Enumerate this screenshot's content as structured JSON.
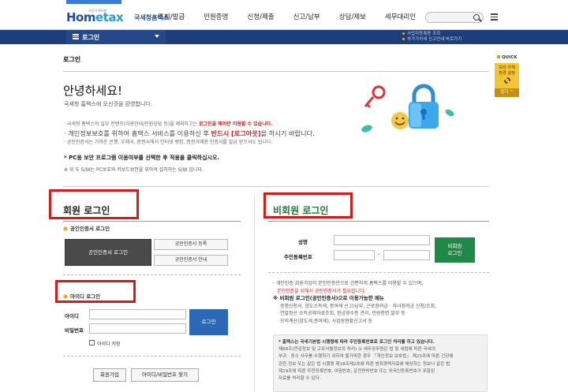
{
  "header": {
    "logo_text_a": "Hom",
    "logo_text_b": "etax",
    "logo_tag": "국민이 편리한",
    "agency": "국세청홈택스",
    "menu": [
      "조회/발급",
      "민원증명",
      "신청/제출",
      "신고/납부",
      "상담/제보",
      "세무대리인"
    ],
    "search_placeholder": ""
  },
  "locbar": {
    "label": "로그인",
    "notice1": "사업자등록증 조회",
    "notice2": "부가가치세 신고안내 바로가기"
  },
  "page": {
    "title": "로그인",
    "hello": "안녕하세요!",
    "welcome": "국세청 홈택스에 오신것을 환영합니다."
  },
  "notes": {
    "l1a": "· 국세청 홈택스의 일부 컨텐츠(이용안내/민원상담 등)을 제외하고는 ",
    "l1b": "로그인을 해야만 이용할 수 있습니다.",
    "l2a": "· 개인정보보호를 위하여 홈택스 서비스를 이용하신 후 ",
    "l2b": "반드시 [로그아웃]",
    "l2c": "을 하시기 바랍니다.",
    "l3": "· 공인인증서는 가까운 은행, 우체국, 증권사에서 인터넷 뱅킹, 증권거래용 인증서를 발급 받으셔도 됩니다.",
    "pc": "* PC용 보안 프로그램 이용여부를 선택한 후 적용을 클릭하십시오.",
    "pc2": "※ 위 두 S/W는 PC보호와 키보드보안을 위하여 설치하는 S/W 입니다."
  },
  "quick": {
    "header": "QUICK",
    "box": [
      "보라 우체",
      "환경 설정"
    ],
    "fold": "접기 ^"
  },
  "member": {
    "heading": "회원 로그인",
    "cert_sub": "공인인증서 로그인",
    "cert_login": "공인인증서 로그인",
    "cert_register": "공인인증서 등록",
    "cert_guide": "공인인증서 안내",
    "id_sub": "아이디 로그인",
    "id_label": "아이디",
    "pw_label": "비밀번호",
    "login_btn": "로그인",
    "save_id": "아이디 저장",
    "join": "회원가입",
    "find": "아이디/비밀번호 찾기"
  },
  "guest": {
    "heading": "비회원 로그인",
    "name_label": "성명",
    "rrn_label": "주민등록번호",
    "rrn_sep": "-",
    "login_btn_1": "비회원",
    "login_btn_2": "로그인",
    "n1": "· 개인인증 회원가입이 본인인증만으로 간편하게 홈택스를 이용할 수 있으며,",
    "n1b": "본인인증을 위해서 공인인증서가 필요합니다.",
    "n2": "※ 비회원 로그인(공인인증서)으로 이용가능한 메뉴",
    "n3": "증명신청서, 양도소득세, 증여세 신고/납부, 근로장려금 · 자녀장려금 신청/조회,",
    "n4": "연말정산 소득공제자료조회, 현금영수증 관리, 민원증명 발부 등",
    "n5": "모의계산(양도세,증여세), 사업장현황신고서 등",
    "b1": "* 홈택스는 국세기본법 시행령에 따라 주민등록번호로 로그인 처리를 하고 있습니다.",
    "b2": "제68조(민감정보 및 고유식별정보의 처리) ① 세무공무원은 법 및 세법에 따른 국세의",
    "b3": "부과 · 징수 사무를 수행하기 위하여 불가피한 경우 「개인정보 보호법」 제23조에 따른 건강에",
    "b4": "관한 정보 또는 같은 법 시행령 제18조제2호에 따른 범죄경력자료에 해당하는 정보나 같은 법",
    "b5": "제19조에 따른 주민등록번호, 여권번호, 운전면허번호 또는 외국인등록번호가 포함된",
    "b6": "자료를 처리할 수 있다."
  }
}
